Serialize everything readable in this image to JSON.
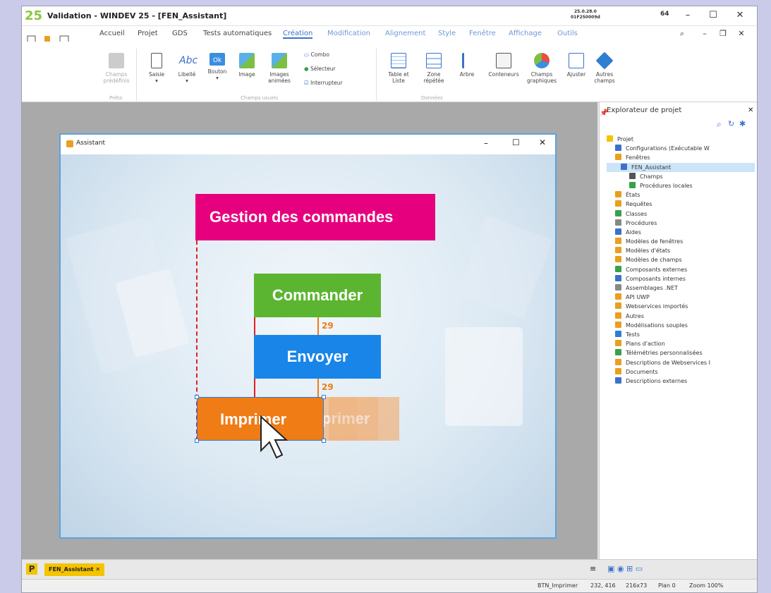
{
  "window": {
    "title": "Validation - WINDEV 25 - [FEN_Assistant]",
    "version_line1": "25.0.28.0",
    "version_line2": "01F250009d",
    "bits": "64",
    "logo": "25"
  },
  "menu": {
    "tabs": [
      "Accueil",
      "Projet",
      "GDS",
      "Tests automatiques",
      "Création",
      "Modification",
      "Alignement",
      "Style",
      "Fenêtre",
      "Affichage",
      "Outils"
    ],
    "active_tab": "Création"
  },
  "ribbon": {
    "buttons": {
      "champs_predefinis": "Champs prédéfinis",
      "saisie": "Saisie",
      "libelle": "Libellé",
      "bouton": "Bouton",
      "image": "Image",
      "images_animees": "Images animées",
      "combo": "Combo",
      "selecteur": "Sélecteur",
      "interrupteur": "Interrupteur",
      "table_liste": "Table et Liste",
      "zone_repetee": "Zone répétée",
      "arbre": "Arbre",
      "conteneurs": "Conteneurs",
      "champs_graphiques": "Champs graphiques",
      "ajuster": "Ajuster",
      "autres_champs": "Autres champs"
    },
    "abc_icon_text": "Abc",
    "ok_icon_text": "Ok",
    "groups": {
      "preta": "Préta",
      "champs_usuels": "Champs usuels",
      "donnees": "Données"
    }
  },
  "form": {
    "title": "Assistant",
    "banner": "Gestion des commandes",
    "btn_commander": "Commander",
    "btn_envoyer": "Envoyer",
    "btn_imprimer": "Imprimer",
    "ghost_text": "primer",
    "gap1": "29",
    "gap2": "29"
  },
  "explorer": {
    "title": "Explorateur de projet",
    "tree": [
      "Projet",
      "Configurations (Exécutable W",
      "Fenêtres",
      "FEN_Assistant",
      "Champs",
      "Procédures locales",
      "États",
      "Requêtes",
      "Classes",
      "Procédures",
      "Aides",
      "Modèles de fenêtres",
      "Modèles d'états",
      "Modèles de champs",
      "Composants externes",
      "Composants internes",
      "Assemblages .NET",
      "API UWP",
      "Webservices importés",
      "Autres",
      "Modélisations souples",
      "Tests",
      "Plans d'action",
      "Télémétries personnalisées",
      "Descriptions de Webservices I",
      "Documents",
      "Descriptions externes"
    ]
  },
  "bottom": {
    "tab_label": "FEN_Assistant",
    "project_icon": "P"
  },
  "status": {
    "control": "BTN_Imprimer",
    "position": "232, 416",
    "size": "216x73",
    "plan": "Plan 0",
    "zoom": "Zoom 100%"
  }
}
